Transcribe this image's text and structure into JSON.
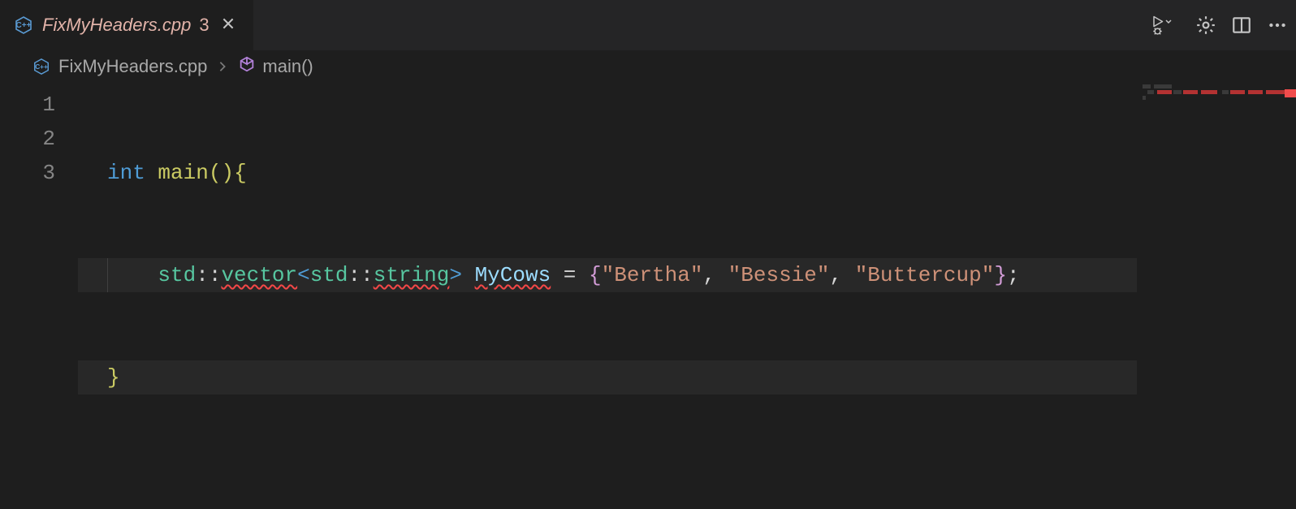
{
  "tab": {
    "filename": "FixMyHeaders.cpp",
    "problem_count": "3",
    "lang_icon_label": "C++"
  },
  "breadcrumb": {
    "file": "FixMyHeaders.cpp",
    "symbol": "main()"
  },
  "code": {
    "line_numbers": [
      "1",
      "2",
      "3"
    ],
    "line1": {
      "kw_int": "int",
      "fn": "main",
      "parens": "()",
      "brace": "{"
    },
    "line2": {
      "ns1": "std",
      "sep": "::",
      "vector": "vector",
      "lt": "<",
      "ns2": "std",
      "string": "string",
      "gt": ">",
      "var": "MyCows",
      "eq": " = ",
      "lb": "{",
      "s1": "\"Bertha\"",
      "c1": ", ",
      "s2": "\"Bessie\"",
      "c2": ", ",
      "s3": "\"Buttercup\"",
      "rb": "}",
      "semi": ";"
    },
    "line3": {
      "brace": "}"
    }
  }
}
